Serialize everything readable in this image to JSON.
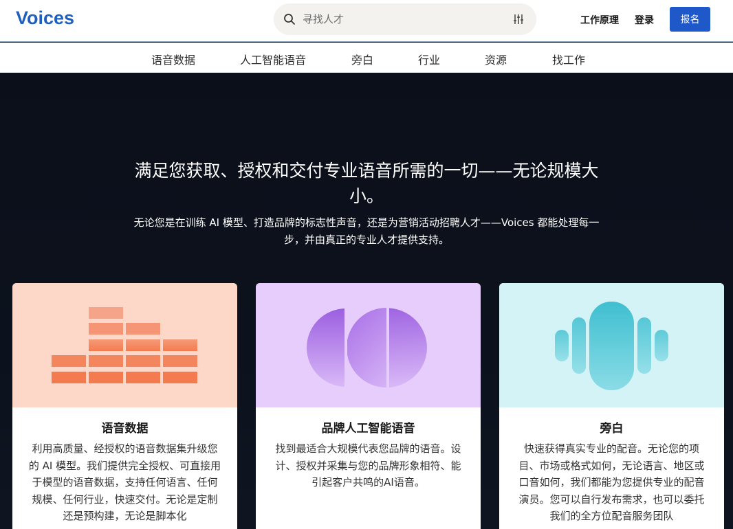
{
  "header": {
    "logo": "Voices",
    "search_placeholder": "寻找人才",
    "how_it_works": "工作原理",
    "login": "登录",
    "signup": "报名"
  },
  "subnav": {
    "tabs": [
      "语音数据",
      "人工智能语音",
      "旁白",
      "行业",
      "资源",
      "找工作"
    ]
  },
  "hero": {
    "title": "满足您获取、授权和交付专业语音所需的一切——无论规模大小。",
    "subtitle": "无论您是在训练 AI 模型、打造品牌的标志性声音，还是为营销活动招聘人才——Voices 都能处理每一步，并由真正的专业人才提供支持。"
  },
  "cards": [
    {
      "title": "语音数据",
      "text": "利用高质量、经授权的语音数据集升级您的 AI 模型。我们提供完全授权、可直接用于模型的语音数据，支持任何语言、任何规模、任何行业，快速交付。无论是定制还是预构建，无论是脚本化",
      "bg": "#fdd8c8",
      "accent": "#f47b4f"
    },
    {
      "title": "品牌人工智能语音",
      "text": "找到最适合大规模代表您品牌的语音。设计、授权并采集与您的品牌形象相符、能引起客户共鸣的AI语音。",
      "bg": "#e6cdfb",
      "accent": "#9a5fe0"
    },
    {
      "title": "旁白",
      "text": "快速获得真实专业的配音。无论您的项目、市场或格式如何，无论语言、地区或口音如何，我们都能为您提供专业的配音演员。您可以自行发布需求，也可以委托我们的全方位配音服务团队",
      "bg": "#d3f3f7",
      "accent": "#3fbfd0"
    }
  ]
}
